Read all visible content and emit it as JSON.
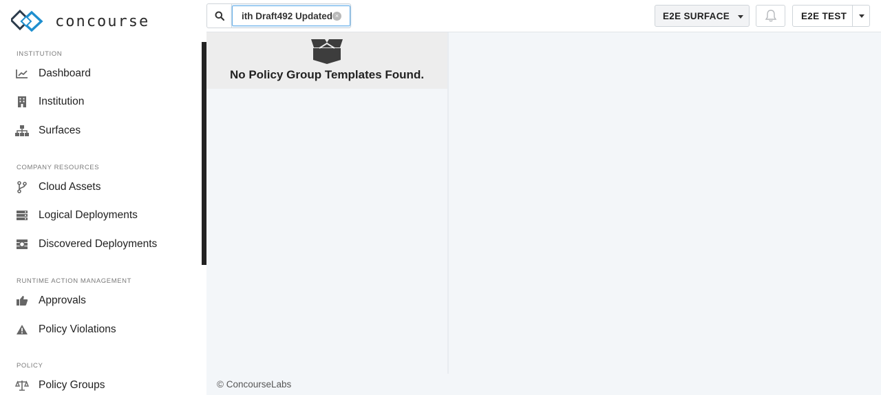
{
  "app": {
    "logo_text": "concourse"
  },
  "sidebar": {
    "sections": [
      {
        "label": "INSTITUTION"
      },
      {
        "label": "COMPANY RESOURCES"
      },
      {
        "label": "RUNTIME ACTION MANAGEMENT"
      },
      {
        "label": "POLICY"
      }
    ],
    "items": [
      {
        "label": "Dashboard",
        "icon": "chart-line-icon"
      },
      {
        "label": "Institution",
        "icon": "building-icon"
      },
      {
        "label": "Surfaces",
        "icon": "sitemap-icon"
      },
      {
        "label": "Cloud Assets",
        "icon": "code-branch-icon"
      },
      {
        "label": "Logical Deployments",
        "icon": "server-icon"
      },
      {
        "label": "Discovered Deployments",
        "icon": "discovered-deployments-icon"
      },
      {
        "label": "Approvals",
        "icon": "thumbs-up-icon"
      },
      {
        "label": "Policy Violations",
        "icon": "warning-icon"
      },
      {
        "label": "Policy Groups",
        "icon": "balance-scale-icon"
      }
    ]
  },
  "header": {
    "search_value": "ith Draft492 Updated",
    "surface_label": "E2E SURFACE",
    "user_label": "E2E TEST"
  },
  "main": {
    "empty_message": "No Policy Group Templates Found."
  },
  "footer": {
    "text": "© ConcourseLabs"
  },
  "colors": {
    "brand_primary": "#1f8fcf",
    "brand_dark": "#2a3a4a",
    "main_background": "#f3f6f9",
    "focus_border": "#66afe9"
  }
}
